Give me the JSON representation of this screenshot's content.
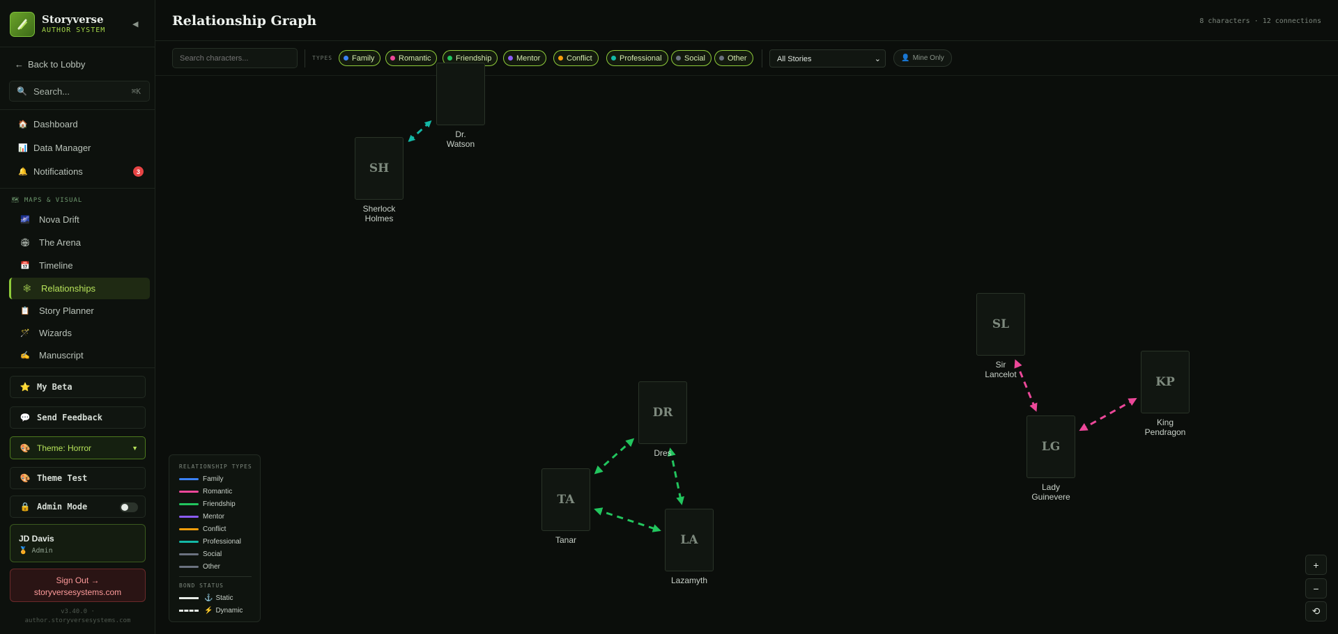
{
  "brand": {
    "title": "Storyverse",
    "subtitle": "AUTHOR SYSTEM",
    "collapse_icon": "◀"
  },
  "sidebar": {
    "back_label": "Back to Lobby",
    "search": {
      "placeholder": "Search...",
      "shortcut": "⌘K"
    },
    "nav": [
      {
        "label": "Dashboard",
        "icon": "🏠"
      },
      {
        "label": "Data Manager",
        "icon": "📊"
      },
      {
        "label": "Notifications",
        "icon": "🔔",
        "badge": "3"
      }
    ],
    "section_label": "MAPS & VISUAL",
    "section_icon": "🗺",
    "visual_items": [
      {
        "label": "Nova Drift",
        "icon": "🌌"
      },
      {
        "label": "The Arena",
        "icon": "🏟"
      },
      {
        "label": "Timeline",
        "icon": "📅"
      },
      {
        "label": "Relationships",
        "icon": "🕸",
        "active": true
      },
      {
        "label": "Story Planner",
        "icon": "📋"
      },
      {
        "label": "Wizards",
        "icon": "🪄"
      },
      {
        "label": "Manuscript",
        "icon": "✍"
      }
    ],
    "buttons": {
      "my_beta": "My Beta",
      "send_feedback": "Send Feedback",
      "theme": "Theme: Horror",
      "theme_test": "Theme Test",
      "admin_mode": "Admin Mode"
    },
    "user": {
      "name": "JD Davis",
      "role": "Admin"
    },
    "signout": {
      "line1": "Sign Out →",
      "line2": "storyversesystems.com"
    },
    "version": {
      "line1": "v3.40.0 ·",
      "line2": "author.storyversesystems.com"
    }
  },
  "header": {
    "title": "Relationship Graph",
    "stats": "8 characters · 12 connections"
  },
  "toolbar": {
    "search_placeholder": "Search characters...",
    "types_label": "TYPES",
    "chips": [
      {
        "label": "Family",
        "color": "#3b82f6"
      },
      {
        "label": "Romantic",
        "color": "#ec4899"
      },
      {
        "label": "Friendship",
        "color": "#22c55e"
      },
      {
        "label": "Mentor",
        "color": "#8b5cf6"
      },
      {
        "label": "Conflict",
        "color": "#f59e0b"
      },
      {
        "label": "Professional",
        "color": "#14b8a6"
      },
      {
        "label": "Social",
        "color": "#6b7280"
      },
      {
        "label": "Other",
        "color": "#6b7280"
      }
    ],
    "stories_select": "All Stories",
    "mine_only": "Mine Only"
  },
  "graph": {
    "nodes": [
      {
        "id": "DW",
        "initials": "",
        "name": "Dr. Watson"
      },
      {
        "id": "SH",
        "initials": "SH",
        "name": "Sherlock Holmes"
      },
      {
        "id": "SL",
        "initials": "SL",
        "name": "Sir Lancelot"
      },
      {
        "id": "KP",
        "initials": "KP",
        "name": "King Pendragon"
      },
      {
        "id": "LG",
        "initials": "LG",
        "name": "Lady Guinevere"
      },
      {
        "id": "DR",
        "initials": "DR",
        "name": "Dres"
      },
      {
        "id": "TA",
        "initials": "TA",
        "name": "Tanar"
      },
      {
        "id": "LA",
        "initials": "LA",
        "name": "Lazamyth"
      }
    ],
    "edges": [
      {
        "from": "SH",
        "to": "DW",
        "type": "Professional",
        "status": "Dynamic"
      },
      {
        "from": "SL",
        "to": "LG",
        "type": "Romantic",
        "status": "Dynamic"
      },
      {
        "from": "LG",
        "to": "KP",
        "type": "Romantic",
        "status": "Dynamic"
      },
      {
        "from": "TA",
        "to": "DR",
        "type": "Friendship",
        "status": "Dynamic"
      },
      {
        "from": "DR",
        "to": "LA",
        "type": "Friendship",
        "status": "Dynamic"
      },
      {
        "from": "TA",
        "to": "LA",
        "type": "Friendship",
        "status": "Dynamic"
      }
    ]
  },
  "legend": {
    "title": "RELATIONSHIP TYPES",
    "types": [
      {
        "label": "Family",
        "color": "#3b82f6"
      },
      {
        "label": "Romantic",
        "color": "#ec4899"
      },
      {
        "label": "Friendship",
        "color": "#22c55e"
      },
      {
        "label": "Mentor",
        "color": "#8b5cf6"
      },
      {
        "label": "Conflict",
        "color": "#f59e0b"
      },
      {
        "label": "Professional",
        "color": "#14b8a6"
      },
      {
        "label": "Social",
        "color": "#6b7280"
      },
      {
        "label": "Other",
        "color": "#6b7280"
      }
    ],
    "status_title": "BOND STATUS",
    "static_label": "Static",
    "dynamic_label": "Dynamic"
  },
  "zoom": {
    "in": "+",
    "out": "−",
    "reset": "⟲"
  }
}
